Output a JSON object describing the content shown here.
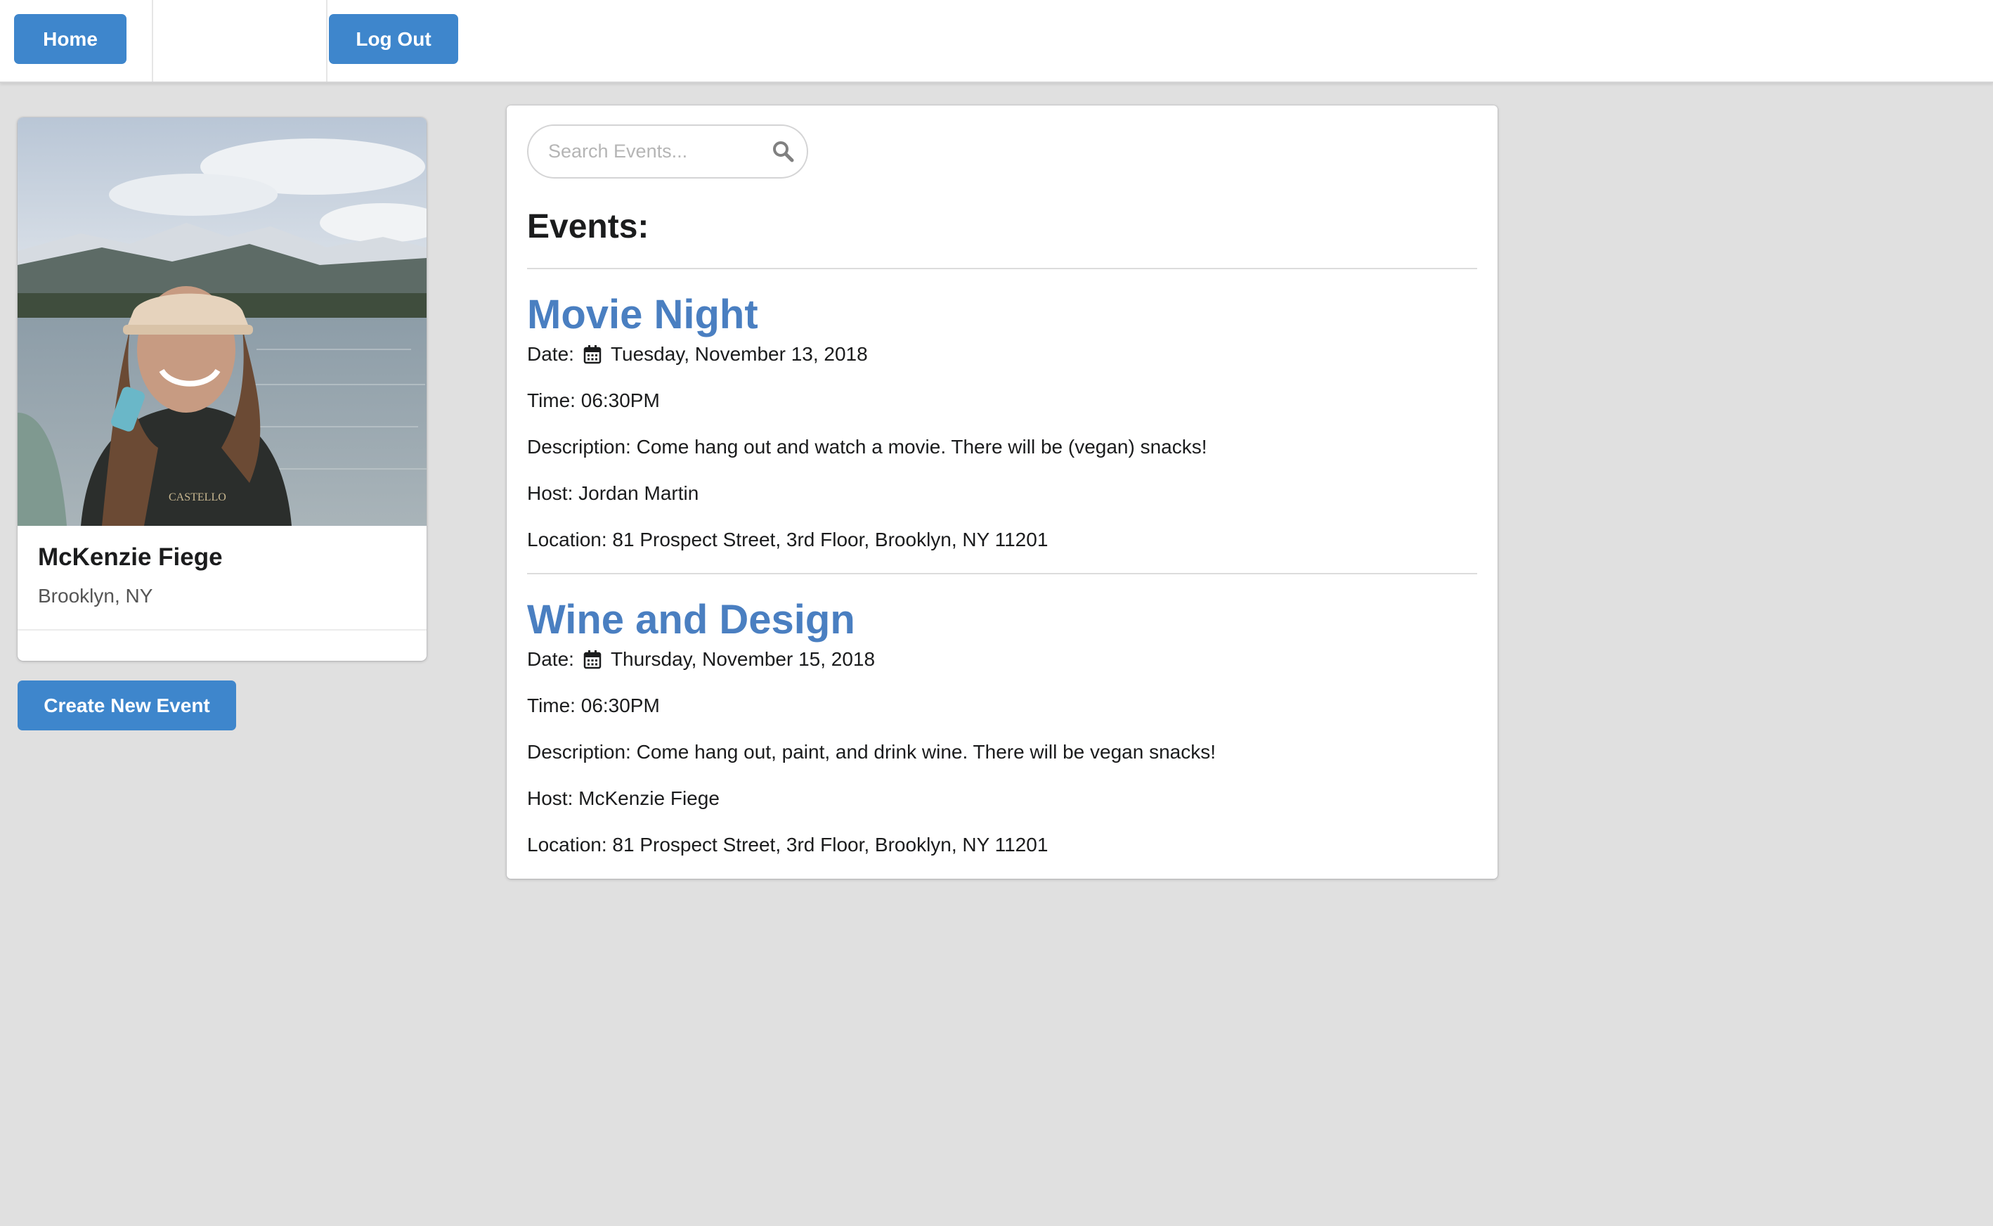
{
  "nav": {
    "home_label": "Home",
    "logout_label": "Log Out"
  },
  "profile": {
    "name": "McKenzie Fiege",
    "location": "Brooklyn, NY",
    "create_event_label": "Create New Event"
  },
  "search": {
    "placeholder": "Search Events...",
    "icon": "search-icon"
  },
  "events_heading": "Events:",
  "events": [
    {
      "title": "Movie Night",
      "date_label": "Date:",
      "date_icon": "calendar-icon",
      "date": "Tuesday, November 13, 2018",
      "time": "Time: 06:30PM",
      "description": "Description: Come hang out and watch a movie. There will be (vegan) snacks!",
      "host": "Host: Jordan Martin",
      "location": "Location: 81 Prospect Street, 3rd Floor, Brooklyn, NY 11201"
    },
    {
      "title": "Wine and Design",
      "date_label": "Date:",
      "date_icon": "calendar-icon",
      "date": "Thursday, November 15, 2018",
      "time": "Time: 06:30PM",
      "description": "Description: Come hang out, paint, and drink wine. There will be vegan snacks!",
      "host": "Host: McKenzie Fiege",
      "location": "Location: 81 Prospect Street, 3rd Floor, Brooklyn, NY 11201"
    }
  ],
  "colors": {
    "accent": "#3e86cc",
    "event_title": "#4a7fc1",
    "background": "#e0e0e0"
  }
}
